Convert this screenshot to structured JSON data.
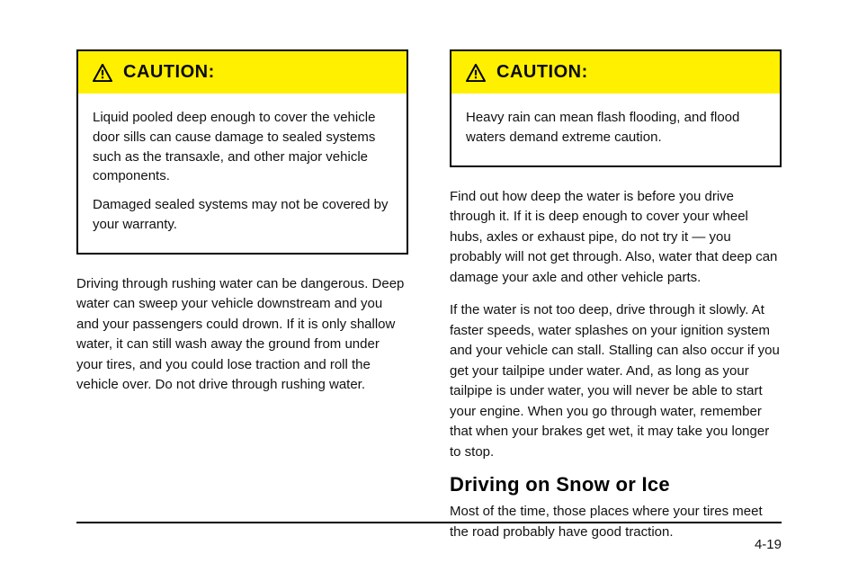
{
  "leftCaution": {
    "title": "CAUTION:",
    "paragraphs": [
      "Liquid pooled deep enough to cover the vehicle door sills can cause damage to sealed systems such as the transaxle, and other major vehicle components.",
      "Damaged sealed systems may not be covered by your warranty."
    ]
  },
  "leftBody": {
    "paragraphs": [
      "Driving through rushing water can be dangerous. Deep water can sweep your vehicle downstream and you and your passengers could drown. If it is only shallow water, it can still wash away the ground from under your tires, and you could lose traction and roll the vehicle over. Do not drive through rushing water."
    ]
  },
  "rightCaution": {
    "title": "CAUTION:",
    "paragraphs": [
      "Heavy rain can mean flash flooding, and flood waters demand extreme caution."
    ]
  },
  "rightAfterCaution": {
    "paragraphs": [
      "Find out how deep the water is before you drive through it. If it is deep enough to cover your wheel hubs, axles or exhaust pipe, do not try it — you probably will not get through. Also, water that deep can damage your axle and other vehicle parts.",
      "If the water is not too deep, drive through it slowly. At faster speeds, water splashes on your ignition system and your vehicle can stall. Stalling can also occur if you get your tailpipe under water. And, as long as your tailpipe is under water, you will never be able to start your engine. When you go through water, remember that when your brakes get wet, it may take you longer to stop."
    ]
  },
  "highwaySection": {
    "heading": "Driving on Snow or Ice",
    "paragraphs": [
      "Most of the time, those places where your tires meet the road probably have good traction."
    ]
  },
  "pageNumber": "4-19"
}
